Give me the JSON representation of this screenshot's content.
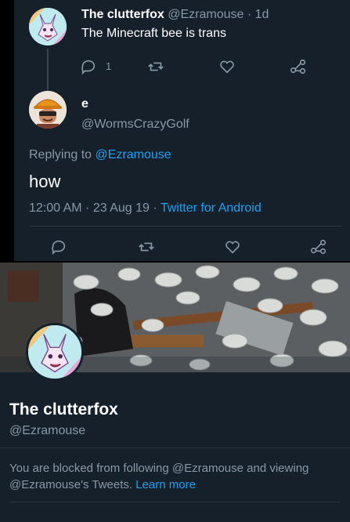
{
  "parent_tweet": {
    "display_name": "The clutterfox",
    "handle": "@Ezramouse",
    "separator": " · ",
    "age": "1d",
    "text": "The Minecraft bee is trans",
    "reply_count": "1"
  },
  "reply_tweet": {
    "display_name": "e",
    "handle": "@WormsCrazyGolf",
    "replying_prefix": "Replying to ",
    "replying_to": "@Ezramouse",
    "text": "how",
    "timestamp": "12:00 AM · 23 Aug 19 · ",
    "source": "Twitter for Android"
  },
  "profile": {
    "display_name": "The clutterfox",
    "handle": "@Ezramouse",
    "blocked_message": "You are blocked from following @Ezramouse and viewing @Ezramouse's Tweets. ",
    "learn_more": "Learn more"
  },
  "icons": [
    "reply-icon",
    "retweet-icon",
    "like-icon",
    "share-icon"
  ],
  "colors": {
    "background": "#15202b",
    "muted": "#8899a6",
    "accent": "#1da1f2"
  }
}
